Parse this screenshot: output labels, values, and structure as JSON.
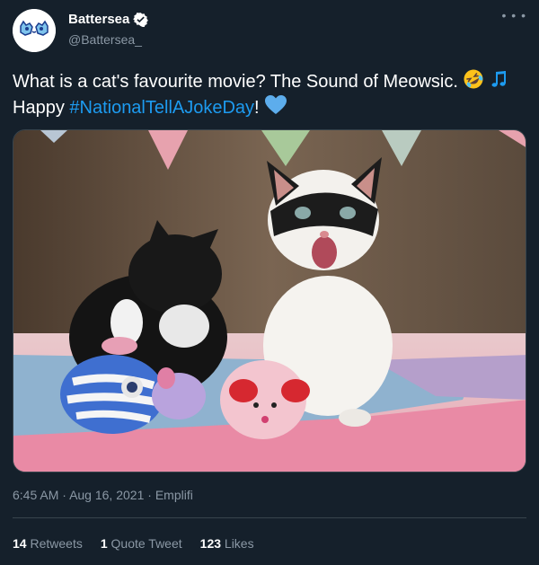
{
  "account": {
    "display_name": "Battersea",
    "handle": "@Battersea_"
  },
  "tweet": {
    "text_main": "What is a cat's favourite movie? The Sound of Meowsic.",
    "text_happy": "Happy",
    "hashtag": "#NationalTellAJokeDay",
    "text_end": "!"
  },
  "meta": {
    "time": "6:45 AM",
    "date": "Aug 16, 2021",
    "source": "Emplifi",
    "sep": "·"
  },
  "stats": {
    "retweets_count": "14",
    "retweets_label": "Retweets",
    "quotes_count": "1",
    "quotes_label": "Quote Tweet",
    "likes_count": "123",
    "likes_label": "Likes"
  },
  "colors": {
    "background": "#15202b",
    "link": "#1d9bf0",
    "secondary_text": "#8b98a5",
    "divider": "#38444d"
  },
  "icons": {
    "verified": "verified-badge-icon",
    "more": "more-horizontal-icon",
    "laugh": "rolling-laughing-emoji-icon",
    "music": "music-notes-emoji-icon",
    "heart": "blue-heart-emoji-icon"
  }
}
